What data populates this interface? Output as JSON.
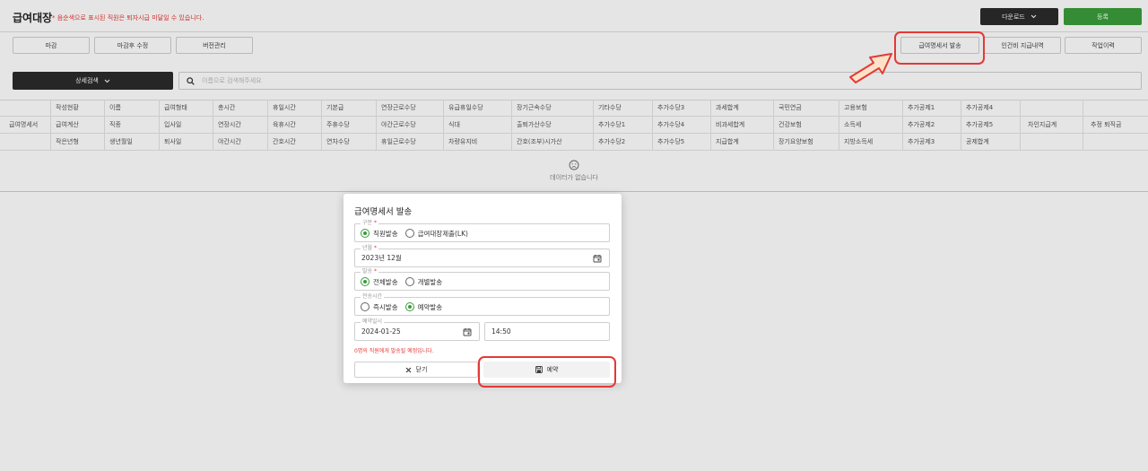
{
  "header": {
    "title": "급여대장",
    "notice": "* 음순색으로 표시된 직원은 퇴자시급 미달일 수 있습니다.",
    "download_label": "다운로드",
    "save_label": "등록"
  },
  "actions": {
    "left": [
      "마감",
      "마감후 수정",
      "버전관리"
    ],
    "right": [
      "급여명세서 발송",
      "인건비 지급내역",
      "작업이력"
    ]
  },
  "search": {
    "detail_label": "상세검색",
    "placeholder": "이름으로 검색해주세요"
  },
  "table": {
    "row_group_label": "급여명세서",
    "rows": [
      [
        "작성현황",
        "이름",
        "급여형태",
        "총시간",
        "휴일시간",
        "기본급",
        "연장근로수당",
        "유급휴일수당",
        "장기근속수당",
        "기타수당",
        "추가수당3",
        "과세합계",
        "국민연금",
        "고용보험",
        "추가공제1",
        "추가공제4"
      ],
      [
        "급여계산",
        "직종",
        "입사일",
        "연장시간",
        "육휴시간",
        "주휴수당",
        "야간근로수당",
        "식대",
        "출퇴가산수당",
        "추가수당1",
        "추가수당4",
        "비과세합계",
        "건강보험",
        "소득세",
        "추가공제2",
        "추가공제5"
      ],
      [
        "작은년형",
        "생년월일",
        "퇴사일",
        "야간시간",
        "간호시간",
        "연차수당",
        "휴일근로수당",
        "차량유지비",
        "간호(조부)시가산",
        "추가수당2",
        "추가수당5",
        "지급합계",
        "장기요양보험",
        "지방소득세",
        "추가공제3",
        "공제합계"
      ]
    ],
    "extra_col1": "차인지급계",
    "extra_col2": "추정 퇴직금",
    "empty_message": "데이터가 없습니다"
  },
  "modal": {
    "title": "급여명세서 발송",
    "type_field": {
      "label": "구분",
      "options": [
        "직원발송",
        "급여대장제출(LK)"
      ],
      "selected": 0
    },
    "month_field": {
      "label": "년월",
      "value": "2023년 12월"
    },
    "send_field": {
      "label": "발송",
      "options": [
        "전체발송",
        "개별발송"
      ],
      "selected": 0
    },
    "time_field": {
      "label": "전송시간",
      "options": [
        "즉시발송",
        "예약발송"
      ],
      "selected": 1
    },
    "schedule_field": {
      "label": "예약일시",
      "date": "2024-01-25",
      "time": "14:50"
    },
    "warning": "0명의 직원에게 발송될 예정입니다.",
    "close_label": "닫기",
    "reserve_label": "예약"
  },
  "colors": {
    "accent_green": "#3a9d3a",
    "dark_button": "#2b2b2b",
    "highlight_red": "#e53935"
  }
}
